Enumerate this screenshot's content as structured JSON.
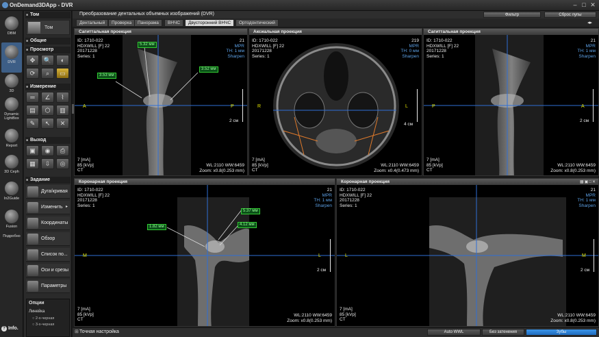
{
  "window": {
    "title": "OnDemand3DApp - DVR"
  },
  "rail": [
    {
      "label": "DBM"
    },
    {
      "label": "DVR"
    },
    {
      "label": "3D"
    },
    {
      "label": "Dynamic LightBox"
    },
    {
      "label": "Report"
    },
    {
      "label": "3D Ceph"
    },
    {
      "label": "In2Guide"
    },
    {
      "label": "Fusion"
    }
  ],
  "rail_more": "Подробно",
  "rail_info": "Info.",
  "tools": {
    "sec_tom": "Том",
    "tom_label": "Том",
    "sec_common": "Общие",
    "sec_view": "Просмотр",
    "sec_measure": "Измерение",
    "sec_output": "Выход",
    "sec_task": "Задание",
    "tasks": [
      "Дуга/кривая",
      "Изменить",
      "Координаты",
      "Обзор",
      "Список по...",
      "Оси и срезы",
      "Параметры"
    ],
    "options_title": "Опции",
    "ruler_label": "Линейка",
    "ruler_opt1": "2-х-черная",
    "ruler_opt2": "3-х-черная"
  },
  "header": {
    "title": "Преобразование дентальных объемных изображений (DVR)",
    "filter_btn": "Фильтр",
    "reset_btn": "Сброс лупы"
  },
  "tabs": [
    "Дентальный",
    "Проверка",
    "Панорама",
    "ВНЧС",
    "Двусторонний ВНЧС",
    "Ортодонтический"
  ],
  "active_tab": 4,
  "viewports": {
    "v1": {
      "title": "Сагиттальная проекция",
      "slice": "21",
      "mode": "MPR",
      "th": "TH: 1 мм",
      "filter": "Sharpen",
      "left": "A",
      "right": "P",
      "zoom": "Zoom: x0.8(0.253 mm)"
    },
    "v2": {
      "title": "Аксиальная проекция",
      "slice": "219",
      "mode": "MPR",
      "th": "TH: 0 мм",
      "filter": "Sharpen",
      "left": "R",
      "right": "L",
      "zoom": "Zoom: x0.4(0.473 mm)"
    },
    "v3": {
      "title": "Сагиттальная проекция",
      "slice": "21",
      "mode": "MPR",
      "th": "TH: 1 мм",
      "filter": "Sharpen",
      "left": "P",
      "right": "A",
      "zoom": "Zoom: x0.8(0.253 mm)"
    },
    "v4": {
      "title": "Коронарная проекция",
      "slice": "21",
      "mode": "MPR",
      "th": "TH: 1 мм",
      "filter": "Sharpen",
      "left": "M",
      "right": "L",
      "zoom": "Zoom: x0.8(0.253 mm)"
    },
    "v5": {
      "title": "Коронарная проекция",
      "slice": "21",
      "mode": "MPR",
      "th": "TH: 1 мм",
      "filter": "Sharpen",
      "left": "L",
      "right": "M",
      "zoom": "Zoom: x0.8(0.253 mm)"
    }
  },
  "patient": {
    "id": "ID: 1710-022",
    "name": "HDXWILL [F] 22",
    "date": "20171228",
    "series": "Series: 1",
    "ma": "7 [mA]",
    "kvp": "85 [kVp]",
    "ct": "CT",
    "wl": "WL:2110 WW:6459"
  },
  "scales": {
    "two_cm": "2 см",
    "four_cm": "4 см"
  },
  "measurements": {
    "m1": "5.32 мм",
    "m2": "3.53 мм",
    "m3": "3.52 мм",
    "m4": "5.37 мм",
    "m5": "4.12 мм",
    "m6": "1.82 мм"
  },
  "bottom": {
    "title": "Точная настройка",
    "auto_wwl": "Auto WWL",
    "no_shade": "Без затенения",
    "teeth": "Зубы"
  },
  "colors": {
    "accent": "#3d5e86",
    "tab_active": "#d8d8d8",
    "crosshair": "#2f6fd6",
    "measure": "#3c3",
    "orient": "#e6e600",
    "teeth_btn": "#2b7fd0"
  }
}
